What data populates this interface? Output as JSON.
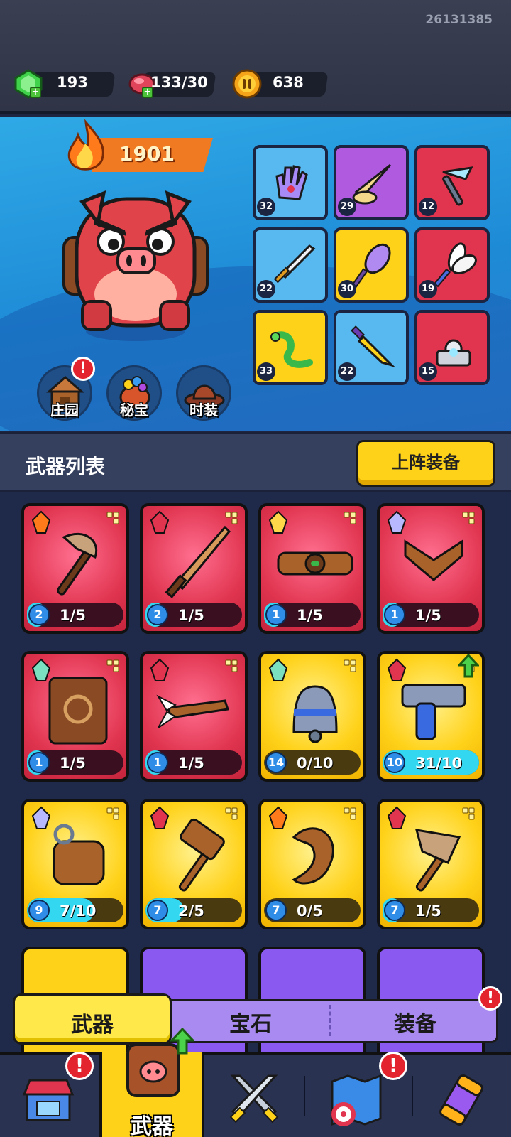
{
  "user_id": "26131385",
  "resources": {
    "gems": "193",
    "stamina": "133/30",
    "coins": "638"
  },
  "hero": {
    "power": "1901",
    "buttons": [
      {
        "label": "庄园"
      },
      {
        "label": "秘宝"
      },
      {
        "label": "时装"
      }
    ]
  },
  "equipped": [
    {
      "level": "32"
    },
    {
      "level": "29"
    },
    {
      "level": "12"
    },
    {
      "level": "22"
    },
    {
      "level": "30"
    },
    {
      "level": "19"
    },
    {
      "level": "33"
    },
    {
      "level": "22"
    },
    {
      "level": "15"
    }
  ],
  "list": {
    "title": "武器列表",
    "equip_button": "上阵装备"
  },
  "weapons": [
    {
      "level": "2",
      "count": "1/5",
      "progress": 0.2
    },
    {
      "level": "2",
      "count": "1/5",
      "progress": 0.2
    },
    {
      "level": "1",
      "count": "1/5",
      "progress": 0.2
    },
    {
      "level": "1",
      "count": "1/5",
      "progress": 0.2
    },
    {
      "level": "1",
      "count": "1/5",
      "progress": 0.2
    },
    {
      "level": "1",
      "count": "1/5",
      "progress": 0.2
    },
    {
      "level": "14",
      "count": "0/10",
      "progress": 0.0
    },
    {
      "level": "10",
      "count": "31/10",
      "progress": 1.0
    },
    {
      "level": "9",
      "count": "7/10",
      "progress": 0.7
    },
    {
      "level": "7",
      "count": "2/5",
      "progress": 0.4
    },
    {
      "level": "7",
      "count": "0/5",
      "progress": 0.0
    },
    {
      "level": "7",
      "count": "1/5",
      "progress": 0.2
    }
  ],
  "tabs": {
    "weapon": "武器",
    "gem": "宝石",
    "equipment": "装备"
  },
  "bottom_nav": {
    "weapon_label": "武器",
    "badge": "!"
  }
}
